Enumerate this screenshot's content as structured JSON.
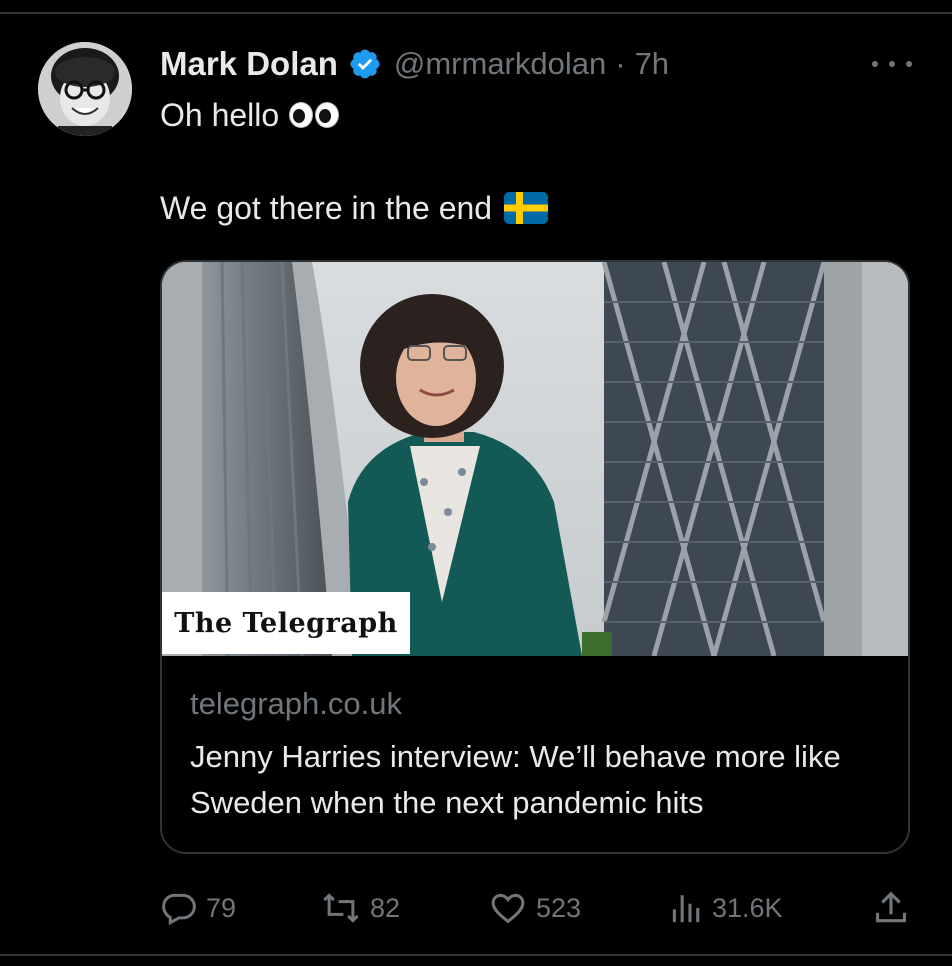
{
  "tweet": {
    "author_name": "Mark Dolan",
    "handle": "@mrmarkdolan",
    "separator": "·",
    "time": "7h",
    "line1": "Oh hello",
    "line2": "We got there in the end"
  },
  "card": {
    "publisher": "The Telegraph",
    "domain": "telegraph.co.uk",
    "title": "Jenny Harries interview: We’ll behave more like Sweden when the next pandemic hits"
  },
  "actions": {
    "replies": "79",
    "reposts": "82",
    "likes": "523",
    "views": "31.6K"
  },
  "colors": {
    "background": "#000000",
    "text": "#e7e9ea",
    "muted": "#71767b",
    "verified": "#1d9bf0",
    "border": "#2f3336"
  },
  "icons": [
    "verified-icon",
    "more-icon",
    "eyes-emoji",
    "sweden-flag-emoji",
    "reply-icon",
    "repost-icon",
    "like-icon",
    "views-icon",
    "share-icon"
  ]
}
